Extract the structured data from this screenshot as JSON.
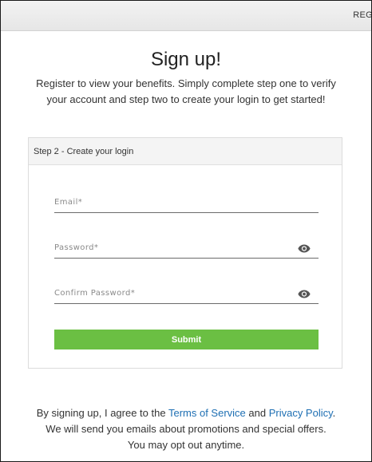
{
  "topbar": {
    "link_label": "REG"
  },
  "heading": {
    "title": "Sign up!",
    "intro": "Register to view your benefits. Simply complete step one to verify your account and step two to create your login to get started!"
  },
  "step": {
    "header": "Step 2 - Create your login",
    "fields": {
      "email": {
        "placeholder": "Email*",
        "value": ""
      },
      "password": {
        "placeholder": "Password*",
        "value": ""
      },
      "confirm_password": {
        "placeholder": "Confirm Password*",
        "value": ""
      }
    },
    "submit_label": "Submit"
  },
  "footer": {
    "agree_prefix": "By signing up, I agree to the ",
    "terms_link": "Terms of Service",
    "and_text": " and ",
    "privacy_link": "Privacy Policy",
    "period": ".",
    "line2": "We will send you emails about promotions and special offers.",
    "line3": "You may opt out anytime."
  },
  "colors": {
    "accent_green": "#6bbf43",
    "link_blue": "#1e6fb3"
  },
  "icons": {
    "password_visibility": "eye-icon"
  }
}
